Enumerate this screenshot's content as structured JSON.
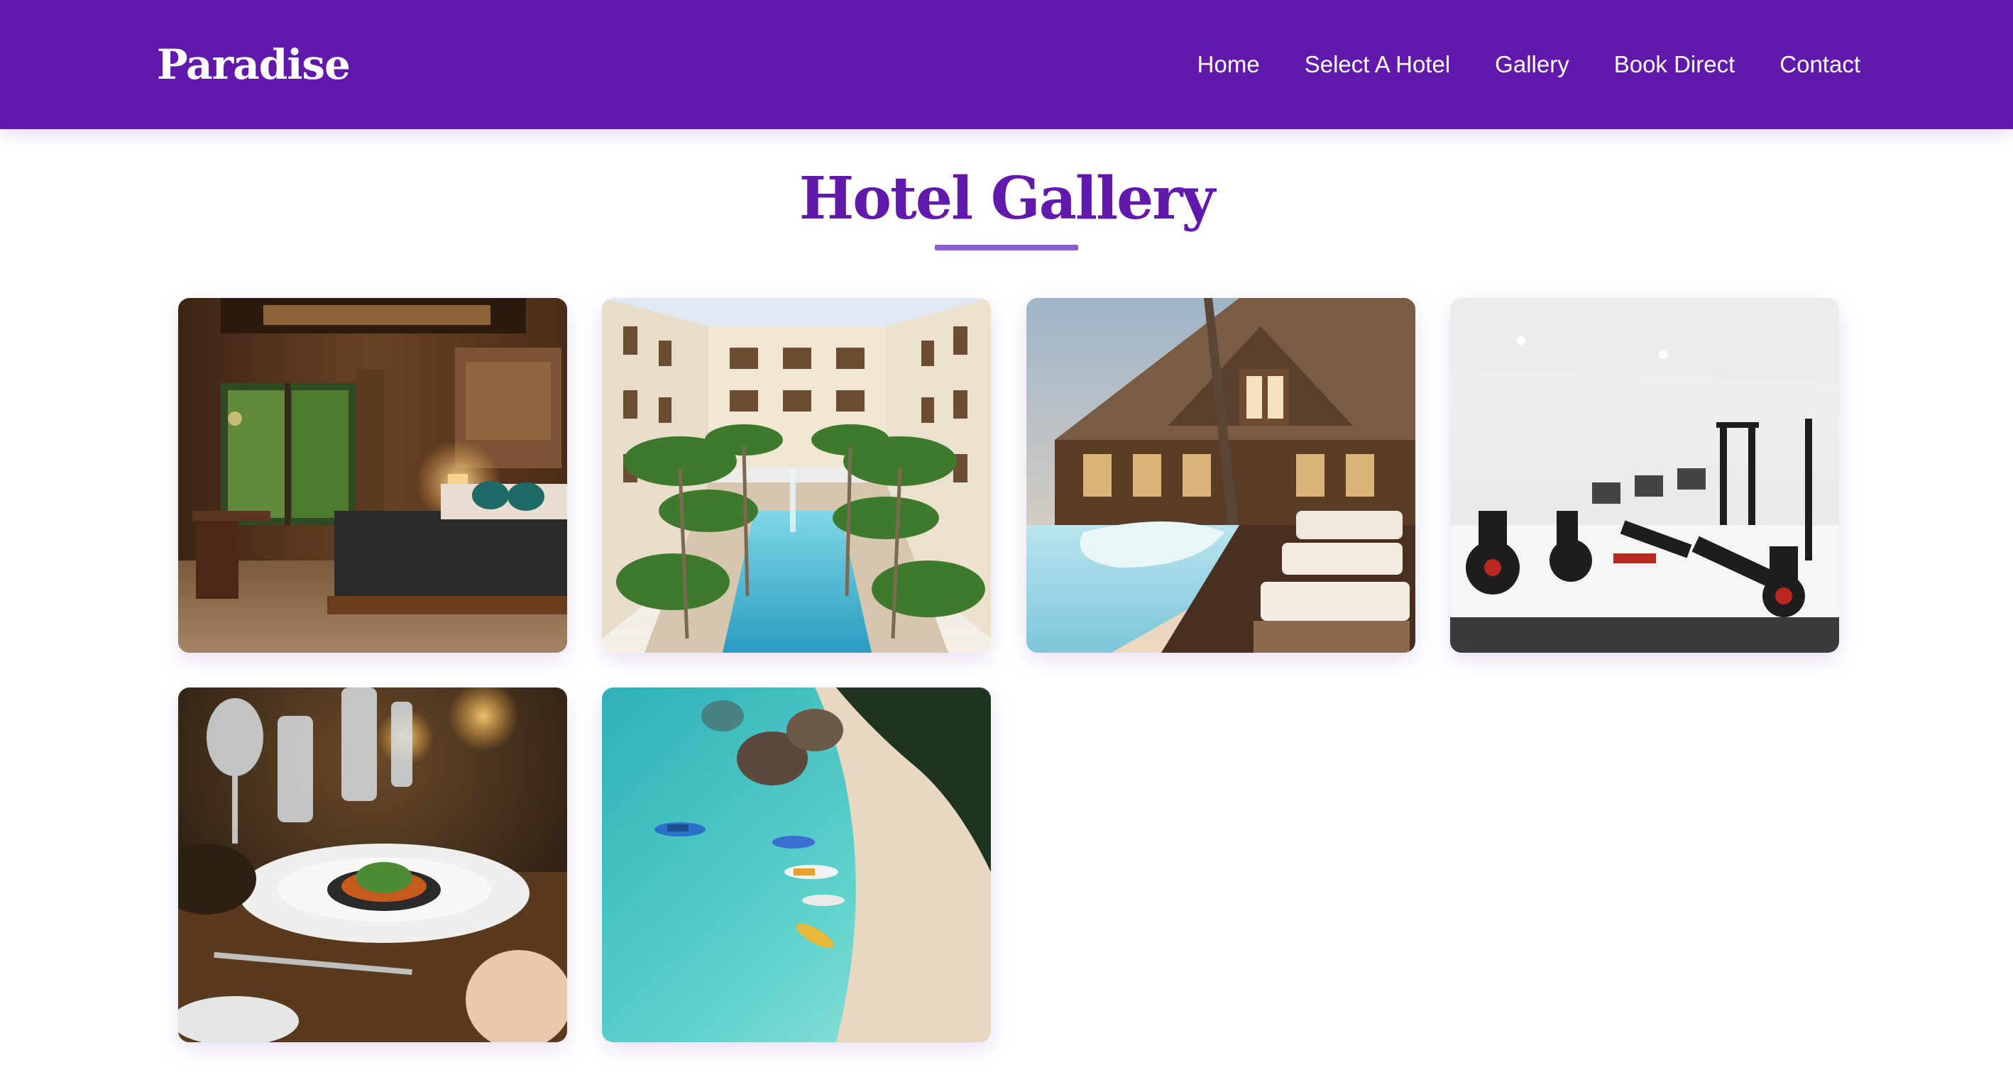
{
  "header": {
    "brand": "Paradise",
    "nav": [
      {
        "label": "Home"
      },
      {
        "label": "Select A Hotel"
      },
      {
        "label": "Gallery"
      },
      {
        "label": "Book Direct"
      },
      {
        "label": "Contact"
      }
    ]
  },
  "main": {
    "title": "Hotel Gallery",
    "gallery": [
      {
        "name": "gallery-image-bedroom"
      },
      {
        "name": "gallery-image-courtyard-pool"
      },
      {
        "name": "gallery-image-poolside-lodge"
      },
      {
        "name": "gallery-image-fitness-center"
      },
      {
        "name": "gallery-image-restaurant-dining"
      },
      {
        "name": "gallery-image-beach-aerial"
      }
    ]
  },
  "colors": {
    "brand_purple": "#6119ab",
    "accent_purple": "#8a5cd6",
    "background": "#ffffff"
  }
}
